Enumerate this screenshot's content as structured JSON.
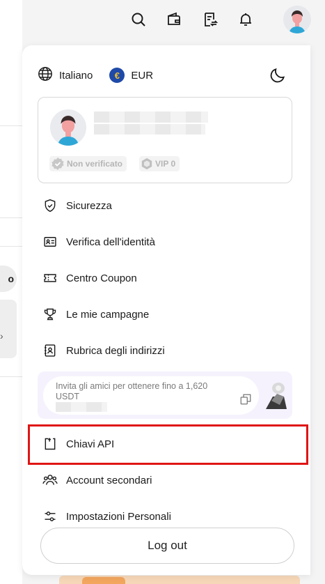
{
  "header": {
    "icons": [
      "search-icon",
      "wallet-icon",
      "orders-icon",
      "bell-icon",
      "avatar"
    ]
  },
  "settings": {
    "language": "Italiano",
    "currency": "EUR",
    "currency_symbol": "€",
    "theme_icon": "moon-icon"
  },
  "profile": {
    "verification_badge": "Non verificato",
    "vip_badge": "VIP 0"
  },
  "menu": {
    "items": [
      {
        "label": "Sicurezza",
        "icon": "shield-icon"
      },
      {
        "label": "Verifica dell'identità",
        "icon": "id-card-icon"
      },
      {
        "label": "Centro Coupon",
        "icon": "ticket-icon"
      },
      {
        "label": "Le mie campagne",
        "icon": "trophy-icon"
      },
      {
        "label": "Rubrica degli indirizzi",
        "icon": "address-book-icon"
      },
      {
        "label": "Chiavi API",
        "icon": "api-key-icon"
      },
      {
        "label": "Account secondari",
        "icon": "users-icon"
      },
      {
        "label": "Impostazioni Personali",
        "icon": "sliders-icon"
      }
    ]
  },
  "invite": {
    "text": "Invita gli amici per ottenere fino a 1,620 USDT"
  },
  "logout_label": "Log out",
  "colors": {
    "highlight": "#e01414",
    "invite_bg": "#f5f2fd",
    "currency_badge": "#1f4aa8"
  }
}
